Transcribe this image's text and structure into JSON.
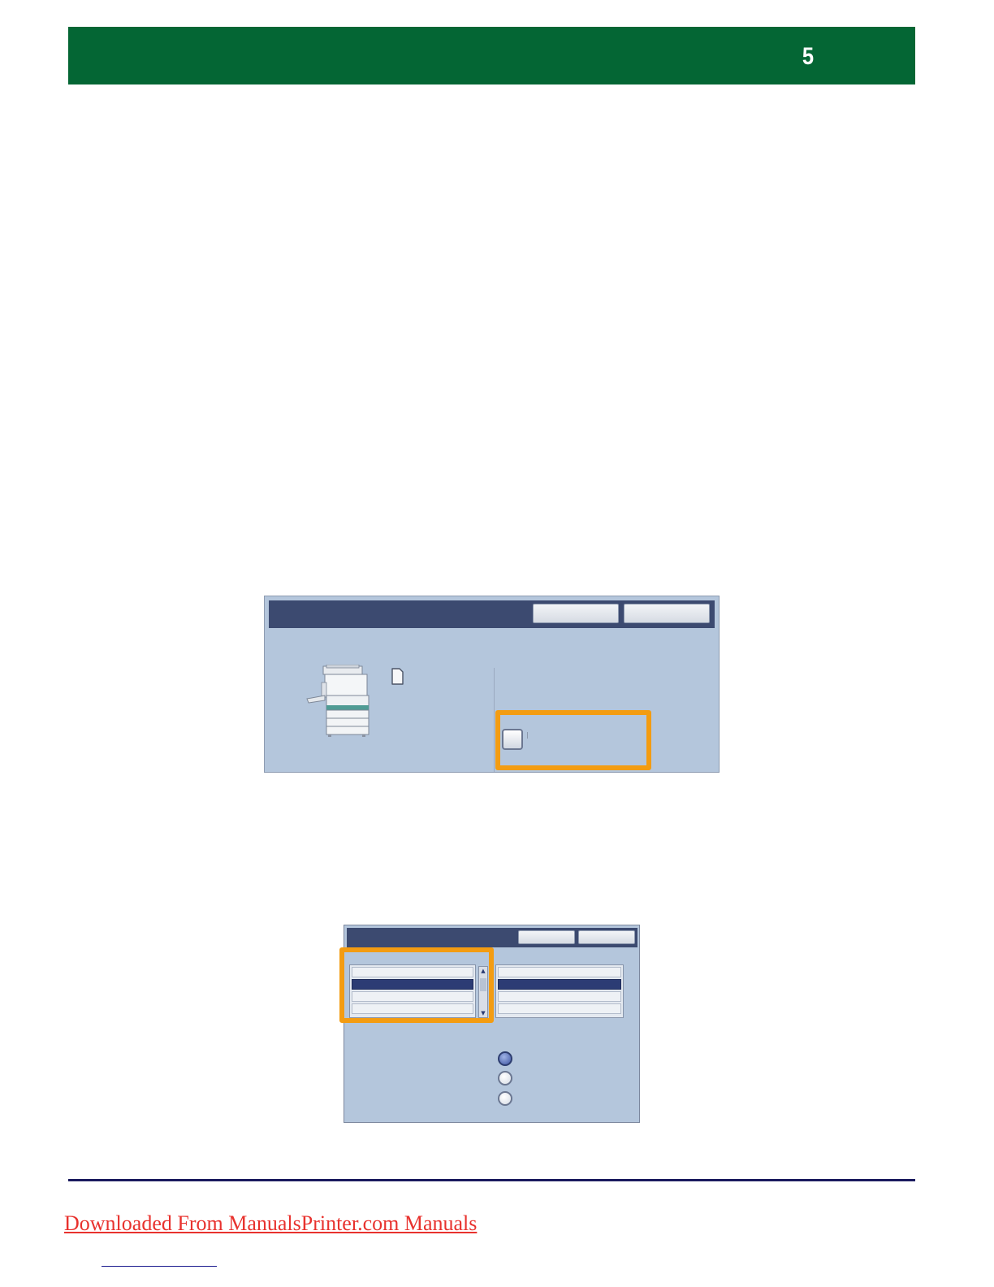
{
  "header": {
    "page_number": "5",
    "band_color": "#046634"
  },
  "screenshot_1": {
    "icons": [
      "printer-icon",
      "document-icon",
      "checkbox"
    ],
    "highlight_color": "#f39c12",
    "checkbox_checked": false
  },
  "screenshot_2": {
    "list_left_rows": 4,
    "list_left_selected_index": 1,
    "list_right_rows": 4,
    "list_right_selected_index": 1,
    "radio_selected_index": 0,
    "highlight_color": "#f39c12"
  },
  "footer": {
    "link_text": "Downloaded From ManualsPrinter.com Manuals",
    "link_color": "#e8322e",
    "rule_color": "#1a1a5e"
  }
}
